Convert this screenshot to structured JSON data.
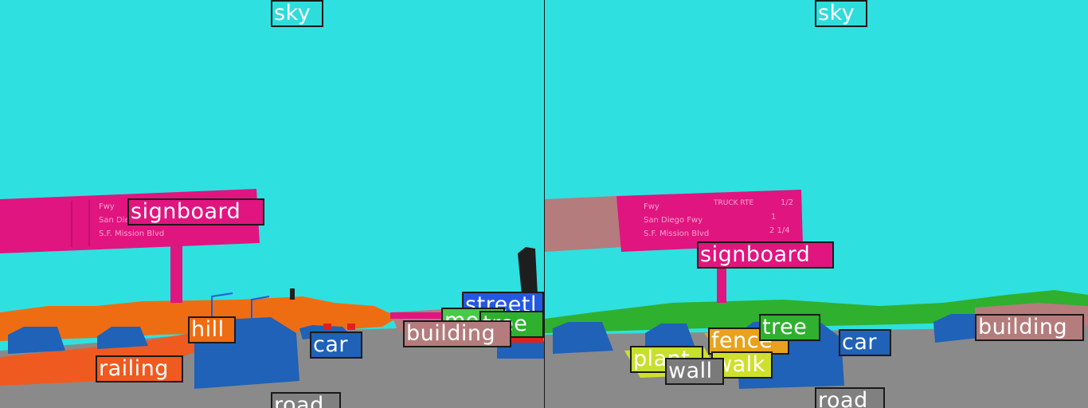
{
  "left_panel": {
    "labels": [
      {
        "text": "sky",
        "color": "#2fdcdc"
      },
      {
        "text": "signboard",
        "color": "#e0157f"
      },
      {
        "text": "hill",
        "color": "#ef6d12"
      },
      {
        "text": "railing",
        "color": "#ef5a20"
      },
      {
        "text": "car",
        "color": "#1f62b7"
      },
      {
        "text": "road",
        "color": "#808080"
      },
      {
        "text": "building",
        "color": "#b47c7c"
      },
      {
        "text": "streetl",
        "color": "#2458e0"
      },
      {
        "text": "tree",
        "color": "#2fb02f"
      },
      {
        "text": "motre",
        "color": "#48c948"
      }
    ]
  },
  "right_panel": {
    "labels": [
      {
        "text": "sky",
        "color": "#2fdcdc"
      },
      {
        "text": "signboard",
        "color": "#e0157f"
      },
      {
        "text": "tree",
        "color": "#2fb02f"
      },
      {
        "text": "fence",
        "color": "#e8a21c"
      },
      {
        "text": "car",
        "color": "#1f62b7"
      },
      {
        "text": "building",
        "color": "#b47c7c"
      },
      {
        "text": "plant",
        "color": "#c6e02c"
      },
      {
        "text": "walk",
        "color": "#cfe02c"
      },
      {
        "text": "wall",
        "color": "#7a7a7a"
      },
      {
        "text": "road",
        "color": "#808080"
      }
    ]
  },
  "sign_text": {
    "line1": "Fwy",
    "line2": "San Diego Fwy",
    "line3": "S.F. Mission Blvd",
    "badge": "TRUCK RTE",
    "frac1": "1/2",
    "frac2": "1",
    "frac3": "2 1/4"
  }
}
